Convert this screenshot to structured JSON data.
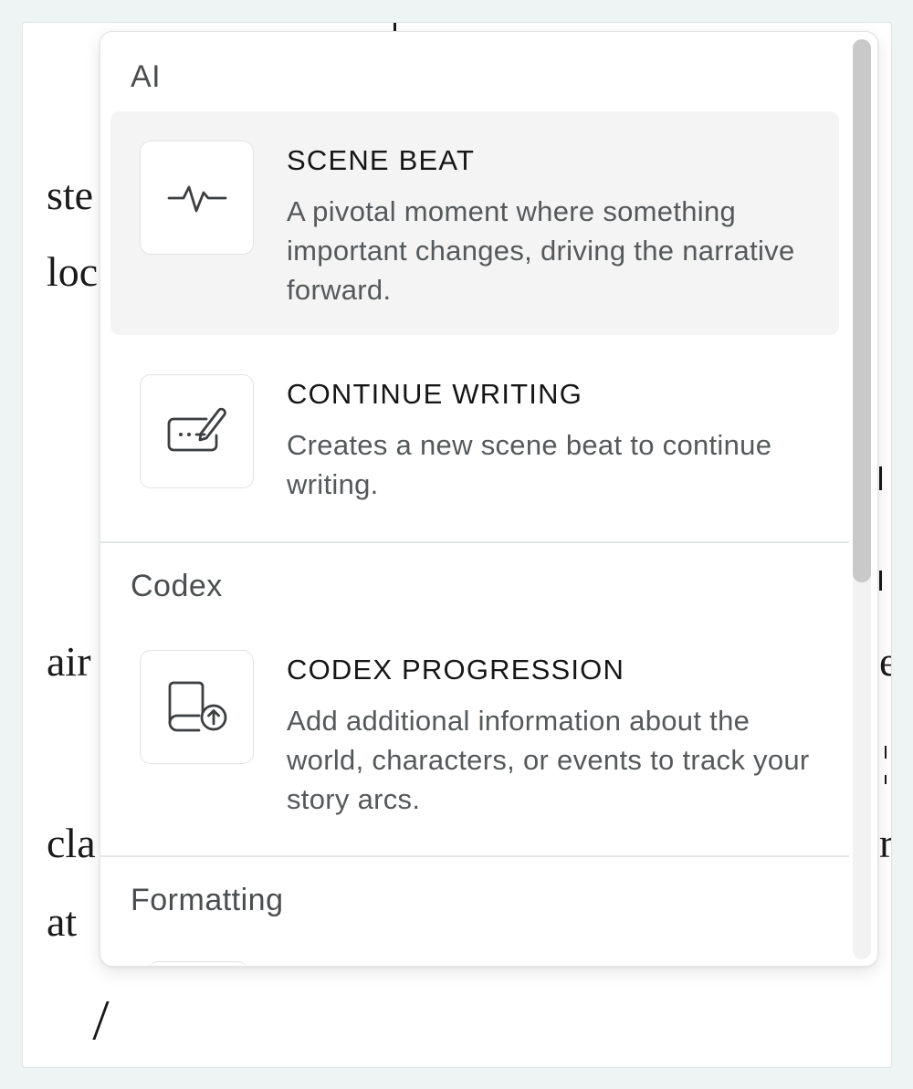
{
  "editor": {
    "fragments": {
      "left_1": "ste",
      "left_2": "loc",
      "left_3": "air",
      "left_4": "cla",
      "left_5": "at",
      "right_1": "e",
      "right_2": "r",
      "slash": "/"
    }
  },
  "menu": {
    "groups": [
      {
        "label": "AI",
        "items": [
          {
            "title": "SCENE BEAT",
            "description": "A pivotal moment where something important changes, driving the narrative forward.",
            "icon": "pulse-icon"
          },
          {
            "title": "CONTINUE WRITING",
            "description": "Creates a new scene beat to continue writing.",
            "icon": "edit-text-icon"
          }
        ]
      },
      {
        "label": "Codex",
        "items": [
          {
            "title": "CODEX PROGRESSION",
            "description": "Add additional information about the world, characters, or events to track your story arcs.",
            "icon": "book-upload-icon"
          }
        ]
      },
      {
        "label": "Formatting",
        "items": []
      }
    ],
    "scroll_position": 0.0,
    "visible_fraction": 0.59
  }
}
